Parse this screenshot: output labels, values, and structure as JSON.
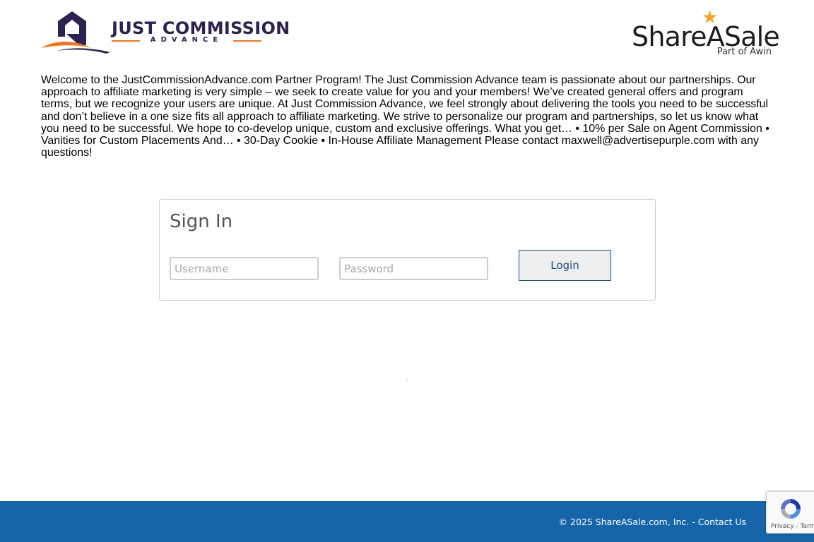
{
  "header": {
    "partner_logo": {
      "name": "JUST COMMISSION",
      "tagline": "ADVANCE",
      "colors": {
        "navy": "#2e2350",
        "orange": "#e87722"
      }
    },
    "network_logo": {
      "name": "ShareASale",
      "sub": "Part of Awin",
      "star_icon": "star-icon",
      "colors": {
        "star": "#f5a623"
      }
    }
  },
  "intro_text": "Welcome to the JustCommissionAdvance.com Partner Program! The Just Commission Advance team is passionate about our partnerships. Our approach to affiliate marketing is very simple – we seek to create value for you and your members! We’ve created general offers and program terms, but we recognize your users are unique. At Just Commission Advance, we feel strongly about delivering the tools you need to be successful and don’t believe in a one size fits all approach to affiliate marketing. We strive to personalize our program and partnerships, so let us know what you need to be successful. We hope to co-develop unique, custom and exclusive offerings. What you get… • 10% per Sale on Agent Commission • Vanities for Custom Placements And… • 30-Day Cookie • In-House Affiliate Management Please contact maxwell@advertisepurple.com with any questions!",
  "signin": {
    "title": "Sign In",
    "username_placeholder": "Username",
    "username_value": "",
    "password_placeholder": "Password",
    "password_value": "",
    "login_label": "Login"
  },
  "footer": {
    "copyright": "© 2025 ShareASale.com, Inc. - ",
    "contact_label": "Contact Us",
    "background_color": "#1565a8"
  },
  "recaptcha": {
    "icon": "recaptcha-icon",
    "links": "Privacy - Terms"
  }
}
